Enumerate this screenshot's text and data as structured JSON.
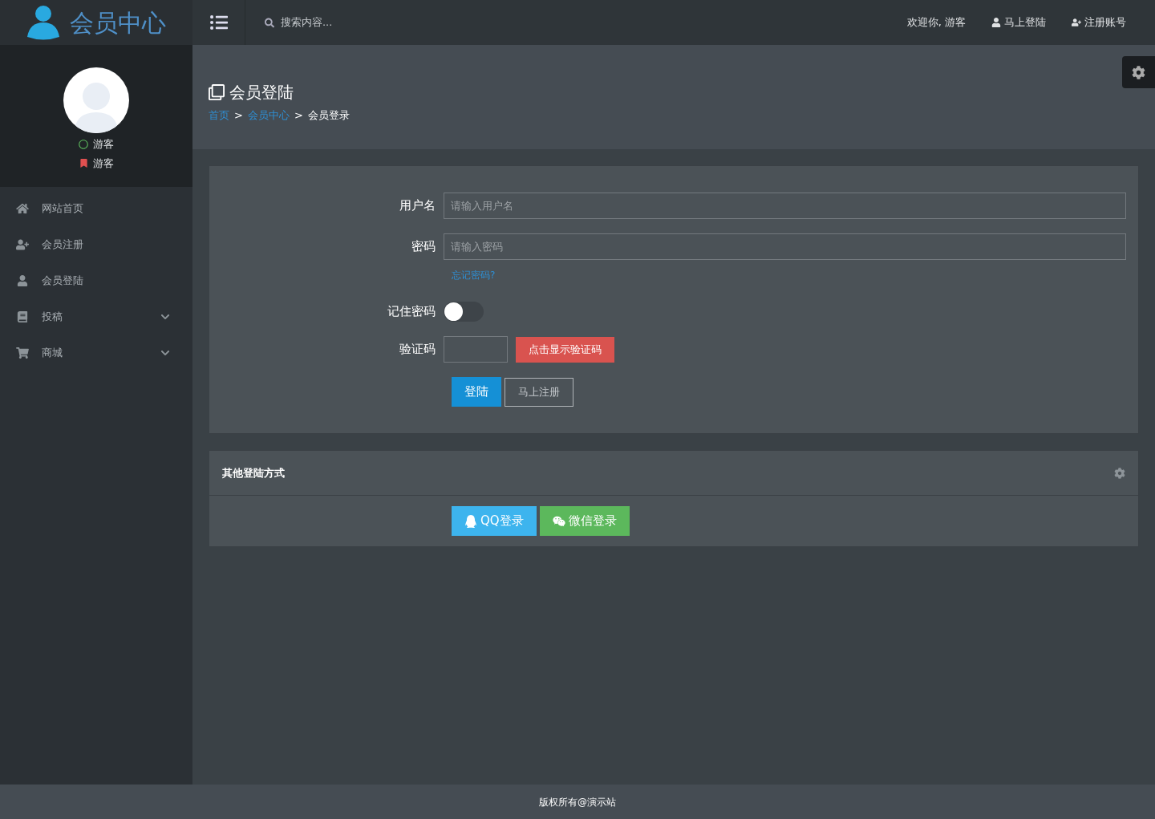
{
  "header": {
    "logo_text": "会员中心",
    "search": {
      "placeholder": "搜索内容..."
    },
    "welcome": "欢迎你, 游客",
    "links": [
      {
        "label": "马上登陆",
        "kind": "user"
      },
      {
        "label": "注册账号",
        "kind": "user-plus"
      }
    ]
  },
  "profile": {
    "status": "游客",
    "role": "游客"
  },
  "sidebar": {
    "items": [
      {
        "label": "网站首页",
        "kind": "link"
      },
      {
        "label": "会员注册",
        "kind": "link"
      },
      {
        "label": "会员登陆",
        "kind": "link"
      },
      {
        "label": "投稿",
        "kind": "submenu"
      },
      {
        "label": "商城",
        "kind": "submenu"
      }
    ]
  },
  "page": {
    "title": "会员登陆",
    "breadcrumb": [
      {
        "label": "首页",
        "kind": "link"
      },
      {
        "label": ">",
        "kind": "separator"
      },
      {
        "label": "会员中心",
        "kind": "link"
      },
      {
        "label": ">",
        "kind": "separator"
      },
      {
        "label": "会员登录",
        "kind": "current"
      }
    ]
  },
  "login_form": {
    "username": {
      "label": "用户名",
      "placeholder": "请输入用户名"
    },
    "password": {
      "label": "密码",
      "placeholder": "请输入密码"
    },
    "forgot_link": "忘记密码?",
    "remember": {
      "label": "记住密码",
      "on": false
    },
    "captcha": {
      "label": "验证码",
      "button": "点击显示验证码"
    },
    "buttons": [
      {
        "label": "登陆",
        "kind": "primary"
      },
      {
        "label": "马上注册",
        "kind": "outline"
      }
    ]
  },
  "other_login": {
    "title": "其他登陆方式",
    "buttons": [
      {
        "label": "QQ登录",
        "kind": "qq"
      },
      {
        "label": "微信登录",
        "kind": "wechat"
      }
    ]
  },
  "footer": "版权所有@演示站"
}
